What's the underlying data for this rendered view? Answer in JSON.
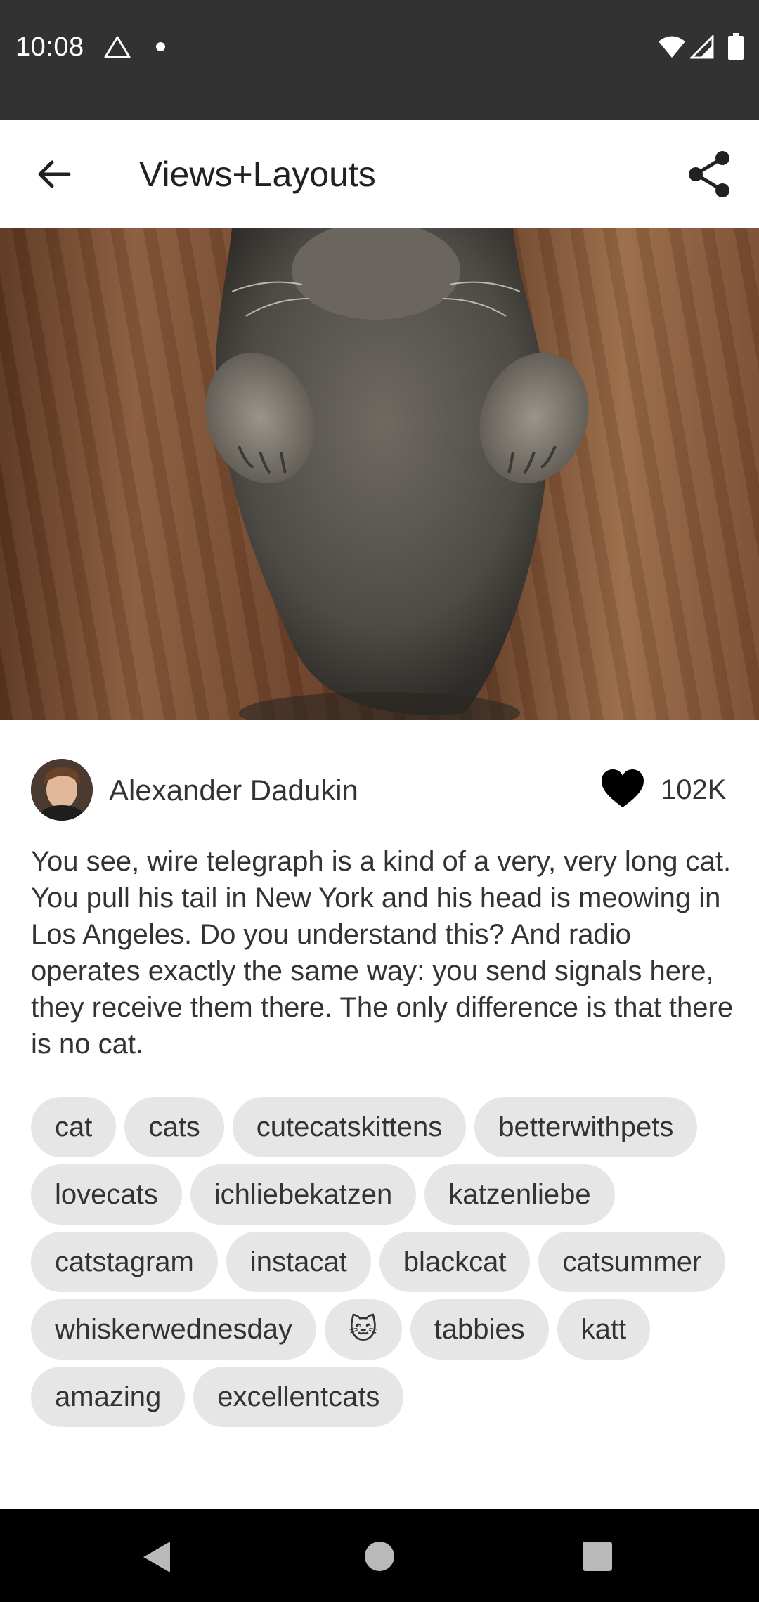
{
  "status_bar": {
    "time": "10:08"
  },
  "app_bar": {
    "title": "Views+Layouts"
  },
  "post": {
    "author": "Alexander Dadukin",
    "likes": "102K",
    "description": "You see, wire telegraph is a kind of a very, very long cat. You pull his tail in New York and his head is meowing in Los Angeles. Do you understand this? And radio operates exactly the same way: you send signals here, they receive them there. The only difference is that there is no cat.",
    "tags": [
      "cat",
      "cats",
      "cutecatskittens",
      "betterwithpets",
      "lovecats",
      "ichliebekatzen",
      "katzenliebe",
      "catstagram",
      "instacat",
      "blackcat",
      "catsummer",
      "whiskerwednesday",
      "🐱",
      "tabbies",
      "katt",
      "amazing",
      "excellentcats"
    ]
  },
  "icons": {
    "back": "arrow-left-icon",
    "share": "share-icon",
    "like": "heart-icon"
  },
  "colors": {
    "status_bar": "#323232",
    "tag_background": "#e6e6e6",
    "nav_bar": "#000000"
  }
}
